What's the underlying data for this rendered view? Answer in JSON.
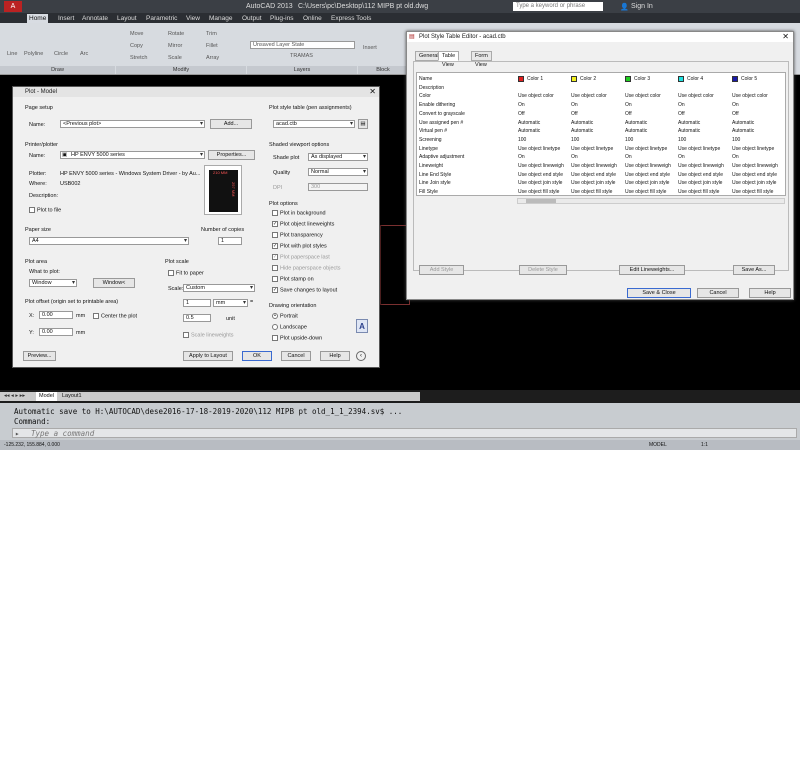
{
  "app": {
    "title": "AutoCAD 2013",
    "file": "C:\\Users\\pc\\Desktop\\112 MIPB pt old.dwg",
    "search_placeholder": "Type a keyword or phrase",
    "sign_in": "Sign In"
  },
  "ribbon_tabs": [
    "Home",
    "Insert",
    "Annotate",
    "Layout",
    "Parametric",
    "View",
    "Manage",
    "Output",
    "Plug-ins",
    "Online",
    "Express Tools"
  ],
  "ribbon": {
    "draw_tools": [
      "Line",
      "Polyline",
      "Circle",
      "Arc"
    ],
    "modify_tools": [
      "Move",
      "Rotate",
      "Trim",
      "Copy",
      "Mirror",
      "Fillet",
      "Stretch",
      "Scale",
      "Array"
    ],
    "layer_state": "Unsaved Layer State",
    "layer_current": "TRAMAS",
    "insert_label": "Insert",
    "panels": [
      "Draw",
      "Modify",
      "Layers",
      "Block"
    ]
  },
  "layout_tabs": [
    "Model",
    "Layout1"
  ],
  "command": {
    "history": "Automatic save to H:\\AUTOCAD\\dese2016-17-18-2019-2020\\112 MIPB pt old_1_1_2394.sv$ ...",
    "prompt": "Command:",
    "placeholder": "Type a command"
  },
  "status": {
    "coords": "-125.232, 155.884, 0.000",
    "model": "MODEL",
    "scale": "1:1"
  },
  "plot_dialog": {
    "title": "Plot - Model",
    "page_setup": "Page setup",
    "name_label": "Name:",
    "page_setup_name": "<Previous plot>",
    "add_button": "Add...",
    "printer_section": "Printer/plotter",
    "printer_name": "HP ENVY 5000 series",
    "properties_button": "Properties...",
    "plotter_label": "Plotter:",
    "plotter_value": "HP ENVY 5000 series - Windows System Driver - by Au...",
    "where_label": "Where:",
    "where_value": "USB002",
    "description_label": "Description:",
    "plot_to_file": "Plot to file",
    "preview_dims_top": "210 MM",
    "preview_dims_side": "297 MM",
    "paper_size_label": "Paper size",
    "paper_size": "A4",
    "copies_label": "Number of copies",
    "copies": "1",
    "plot_area_label": "Plot area",
    "what_to_plot_label": "What to plot:",
    "what_to_plot": "Window",
    "window_button": "Window<",
    "plot_offset_label": "Plot offset (origin set to printable area)",
    "x_label": "X:",
    "x_value": "0.00",
    "y_label": "Y:",
    "y_value": "0.00",
    "mm": "mm",
    "center_plot": "Center the plot",
    "plot_scale_label": "Plot scale",
    "fit_to_paper": "Fit to paper",
    "scale_label": "Scale:",
    "scale_value": "Custom",
    "scale_num": "1",
    "scale_unit": "mm",
    "equals": "=",
    "scale_den": "0.5",
    "unit": "unit",
    "scale_lineweights": "Scale lineweights",
    "pst_label": "Plot style table (pen assignments)",
    "pst_value": "acad.ctb",
    "shaded_label": "Shaded viewport options",
    "shade_plot_label": "Shade plot",
    "shade_plot": "As displayed",
    "quality_label": "Quality",
    "quality": "Normal",
    "dpi_label": "DPI",
    "dpi": "300",
    "plot_options_label": "Plot options",
    "options": [
      {
        "label": "Plot in background",
        "checked": false,
        "disabled": false
      },
      {
        "label": "Plot object lineweights",
        "checked": true,
        "disabled": false
      },
      {
        "label": "Plot transparency",
        "checked": false,
        "disabled": false
      },
      {
        "label": "Plot with plot styles",
        "checked": true,
        "disabled": false
      },
      {
        "label": "Plot paperspace last",
        "checked": true,
        "disabled": true
      },
      {
        "label": "Hide paperspace objects",
        "checked": false,
        "disabled": true
      },
      {
        "label": "Plot stamp on",
        "checked": false,
        "disabled": false
      },
      {
        "label": "Save changes to layout",
        "checked": true,
        "disabled": false
      }
    ],
    "orientation_label": "Drawing orientation",
    "portrait": "Portrait",
    "landscape": "Landscape",
    "upside_down": "Plot upside-down",
    "orientation_icon": "A",
    "preview_button": "Preview...",
    "apply_button": "Apply to Layout",
    "ok_button": "OK",
    "cancel_button": "Cancel",
    "help_button": "Help"
  },
  "pst_editor": {
    "title": "Plot Style Table Editor - acad.ctb",
    "tabs": [
      "General",
      "Table View",
      "Form View"
    ],
    "columns": [
      {
        "name": "Color 1",
        "swatch": "#e02020"
      },
      {
        "name": "Color 2",
        "swatch": "#f2f020"
      },
      {
        "name": "Color 3",
        "swatch": "#20d020"
      },
      {
        "name": "Color 4",
        "swatch": "#20e0e0"
      },
      {
        "name": "Color 5",
        "swatch": "#1a1aa8"
      },
      {
        "name": "",
        "swatch": "#d020d0"
      }
    ],
    "rows": [
      {
        "label": "Name",
        "values": []
      },
      {
        "label": "Description",
        "values": [
          "",
          "",
          "",
          "",
          "",
          ""
        ]
      },
      {
        "label": "Color",
        "values": [
          "Use object color",
          "Use object color",
          "Use object color",
          "Use object color",
          "Use object color",
          "Use ob"
        ]
      },
      {
        "label": "Enable dithering",
        "values": [
          "On",
          "On",
          "On",
          "On",
          "On",
          "On"
        ]
      },
      {
        "label": "Convert to grayscale",
        "values": [
          "Off",
          "Off",
          "Off",
          "Off",
          "Off",
          "Off"
        ]
      },
      {
        "label": "Use assigned pen #",
        "values": [
          "Automatic",
          "Automatic",
          "Automatic",
          "Automatic",
          "Automatic",
          "Auton"
        ]
      },
      {
        "label": "Virtual pen #",
        "values": [
          "Automatic",
          "Automatic",
          "Automatic",
          "Automatic",
          "Automatic",
          "Auton"
        ]
      },
      {
        "label": "Screening",
        "values": [
          "100",
          "100",
          "100",
          "100",
          "100",
          "100"
        ]
      },
      {
        "label": "Linetype",
        "values": [
          "Use object linetype",
          "Use object linetype",
          "Use object linetype",
          "Use object linetype",
          "Use object linetype",
          "Use ob"
        ]
      },
      {
        "label": "Adaptive adjustment",
        "values": [
          "On",
          "On",
          "On",
          "On",
          "On",
          "On"
        ]
      },
      {
        "label": "Lineweight",
        "values": [
          "Use object lineweigh",
          "Use object lineweigh",
          "Use object lineweigh",
          "Use object lineweigh",
          "Use object lineweigh",
          "Use ob"
        ]
      },
      {
        "label": "Line End Style",
        "values": [
          "Use object end style",
          "Use object end style",
          "Use object end style",
          "Use object end style",
          "Use object end style",
          "Use ob"
        ]
      },
      {
        "label": "Line Join style",
        "values": [
          "Use object join style",
          "Use object join style",
          "Use object join style",
          "Use object join style",
          "Use object join style",
          "Use ob"
        ]
      },
      {
        "label": "Fill Style",
        "values": [
          "Use object fill style",
          "Use object fill style",
          "Use object fill style",
          "Use object fill style",
          "Use object fill style",
          "Use ob"
        ]
      }
    ],
    "add_style": "Add Style",
    "delete_style": "Delete Style",
    "edit_lineweights": "Edit Lineweights...",
    "save_as": "Save As...",
    "save_close": "Save & Close",
    "cancel": "Cancel",
    "help": "Help"
  }
}
